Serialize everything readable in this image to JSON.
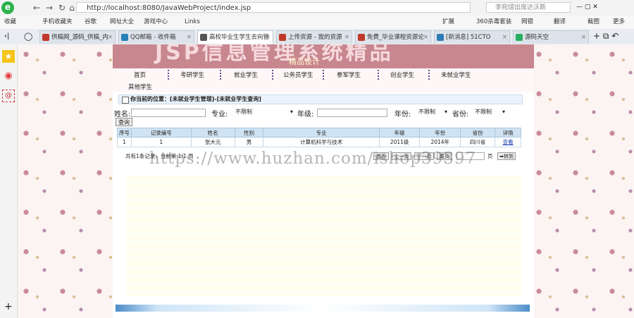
{
  "browser": {
    "url": "http://localhost:8080/JavaWebProject/index.jsp",
    "search_text": "李宛熠出席达沃斯",
    "toolbar_right": [
      "扩展",
      "360杀毒套装",
      "网银",
      "翻译",
      "截图",
      "更多"
    ],
    "favorites": [
      "收藏",
      "手机收藏夹",
      "谷歌",
      "网址大全",
      "游戏中心",
      "Links"
    ],
    "tabs": [
      {
        "label": "供稿网_源码_供稿_内",
        "color": "#c0392b"
      },
      {
        "label": "QQ邮箱 - 收件箱",
        "color": "#2980b9"
      },
      {
        "label": "高校毕业生学生去向管",
        "color": "#555555",
        "active": true
      },
      {
        "label": "上传资源 - 我的资源",
        "color": "#c0392b"
      },
      {
        "label": "免费_毕业课程资源论",
        "color": "#c0392b"
      },
      {
        "label": "[新消息] 51CTO",
        "color": "#2c7bb6"
      },
      {
        "label": "源码天空",
        "color": "#27ae60"
      }
    ]
  },
  "site": {
    "banner_title": "JSP信息管理系统精品",
    "banner_sub": "精品设计",
    "menu": [
      "首页",
      "考研学生",
      "就业学生",
      "公务员学生",
      "参军学生",
      "创业学生",
      "未就业学生",
      "其他学生"
    ]
  },
  "crumb": "你当前的位置：[未就业学生管理]-[未就业学生查询]",
  "filters": {
    "name_label": "姓名:",
    "major_label": "专业:",
    "major_value": "不限制",
    "grade_label": "年级:",
    "year_label": "年份:",
    "year_value": "不限制",
    "province_label": "省份:",
    "province_value": "不限制",
    "query_button": "查询"
  },
  "table": {
    "headers": [
      "序号",
      "记录编号",
      "姓名",
      "性别",
      "专业",
      "年级",
      "年份",
      "省份",
      "详情"
    ],
    "rows": [
      [
        "1",
        "1",
        "张大元",
        "男",
        "计算机科学与技术",
        "2011级",
        "2014年",
        "四川省",
        "查看"
      ]
    ]
  },
  "pager": {
    "summary": "共有1条记录，当前第 1/1 页",
    "buttons": [
      "首页",
      "上一页",
      "下一页",
      "尾页"
    ],
    "page_suffix": "页",
    "go_button": "转到"
  },
  "watermark": "https://www.huzhan.com/ishop39397"
}
